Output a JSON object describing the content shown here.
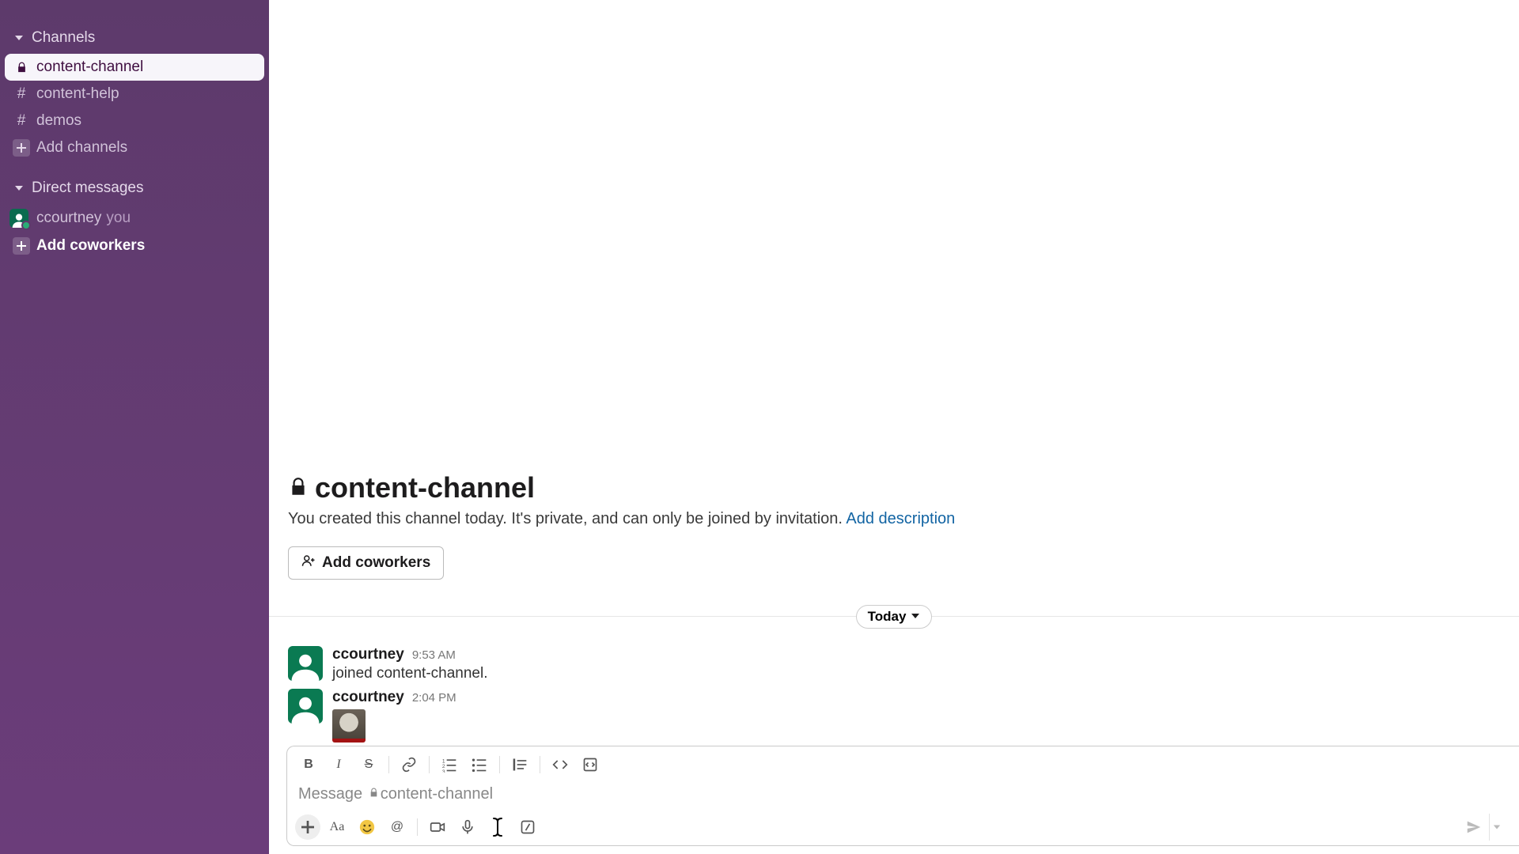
{
  "sidebar": {
    "channels_header": "Channels",
    "dm_header": "Direct messages",
    "channels": [
      {
        "name": "content-channel",
        "locked": true,
        "selected": true
      },
      {
        "name": "content-help",
        "locked": false,
        "selected": false
      },
      {
        "name": "demos",
        "locked": false,
        "selected": false
      }
    ],
    "add_channels": "Add channels",
    "dm_user": "ccourtney",
    "dm_you_label": "you",
    "add_coworkers": "Add coworkers"
  },
  "hero": {
    "title": "content-channel",
    "description": "You created this channel today. It's private, and can only be joined by invitation. ",
    "add_description_link": "Add description",
    "add_coworkers_btn": "Add coworkers"
  },
  "date_divider": "Today",
  "messages": [
    {
      "author": "ccourtney",
      "time": "9:53 AM",
      "text": "joined content-channel.",
      "has_image": false
    },
    {
      "author": "ccourtney",
      "time": "2:04 PM",
      "text": "",
      "has_image": true
    }
  ],
  "composer": {
    "placeholder_prefix": "Message ",
    "placeholder_channel": "content-channel"
  }
}
